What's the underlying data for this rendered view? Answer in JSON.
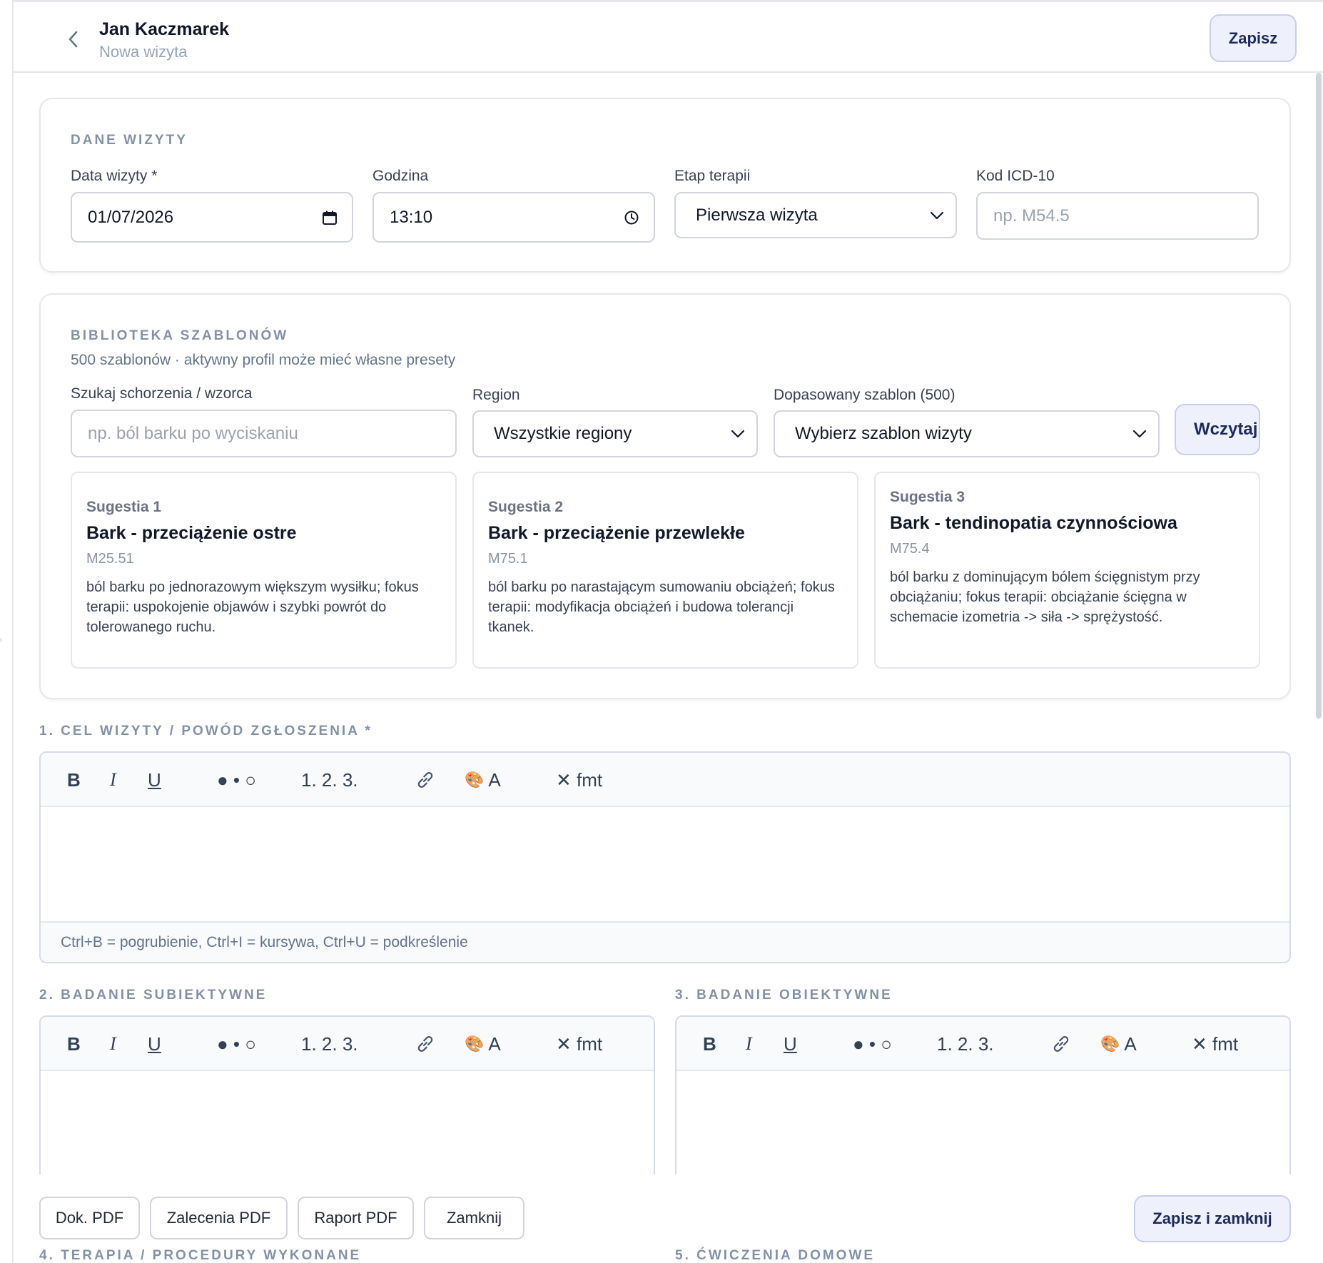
{
  "header": {
    "patient_name": "Jan Kaczmarek",
    "subtitle": "Nowa wizyta",
    "save_label": "Zapisz"
  },
  "visit": {
    "section_title": "DANE WIZYTY",
    "date_label": "Data wizyty *",
    "date_value": "01/07/2026",
    "time_label": "Godzina",
    "time_value": "13:10",
    "stage_label": "Etap terapii",
    "stage_value": "Pierwsza wizyta",
    "icd_label": "Kod ICD-10",
    "icd_placeholder": "np. M54.5"
  },
  "library": {
    "section_title": "BIBLIOTEKA SZABLONÓW",
    "description": "500 szablonów · aktywny profil może mieć własne presety",
    "search_label": "Szukaj schorzenia / wzorca",
    "search_placeholder": "np. ból barku po wyciskaniu",
    "region_label": "Region",
    "region_value": "Wszystkie regiony",
    "template_label": "Dopasowany szablon (500)",
    "template_value": "Wybierz szablon wizyty",
    "load_label": "Wczytaj",
    "suggestions": [
      {
        "tag": "Sugestia 1",
        "title": "Bark - przeciążenie ostre",
        "code": "M25.51",
        "text": "ból barku po jednorazowym większym wysiłku; fokus terapii: uspokojenie objawów i szybki powrót do tolerowanego ruchu."
      },
      {
        "tag": "Sugestia 2",
        "title": "Bark - przeciążenie przewlekłe",
        "code": "M75.1",
        "text": "ból barku po narastającym sumowaniu obciążeń; fokus terapii: modyfikacja obciążeń i budowa tolerancji tkanek."
      },
      {
        "tag": "Sugestia 3",
        "title": "Bark - tendinopatia czynnościowa",
        "code": "M75.4",
        "text": "ból barku z dominującym bólem ścięgnistym przy obciążaniu; fokus terapii: obciążanie ścięgna w schemacie izometria -> siła -> sprężystość."
      }
    ]
  },
  "toolbar": {
    "bold": "B",
    "italic": "I",
    "underline": "U",
    "bullets": "● • ○",
    "numbered": "1. 2. 3.",
    "color_label": "A",
    "clear": "✕ fmt",
    "icons": {
      "link": "link-icon",
      "palette": "palette-icon"
    }
  },
  "sections": {
    "goal_title": "1. CEL WIZYTY / POWÓD ZGŁOSZENIA *",
    "goal_hint": "Ctrl+B = pogrubienie, Ctrl+I = kursywa, Ctrl+U = podkreślenie",
    "subjective_title": "2. BADANIE SUBIEKTYWNE",
    "objective_title": "3. BADANIE OBIEKTYWNE",
    "therapy_title": "4. TERAPIA / PROCEDURY WYKONANE",
    "exercises_title": "5. ĆWICZENIA DOMOWE"
  },
  "footer": {
    "doc_pdf": "Dok. PDF",
    "recommendations_pdf": "Zalecenia PDF",
    "report_pdf": "Raport PDF",
    "close": "Zamknij",
    "save_close": "Zapisz i zamknij"
  },
  "colors": {
    "accent_bg": "#eef0fb",
    "accent_border": "#c7cdee",
    "accent_text": "#1e2a5a",
    "section_title": "#8391a7"
  }
}
